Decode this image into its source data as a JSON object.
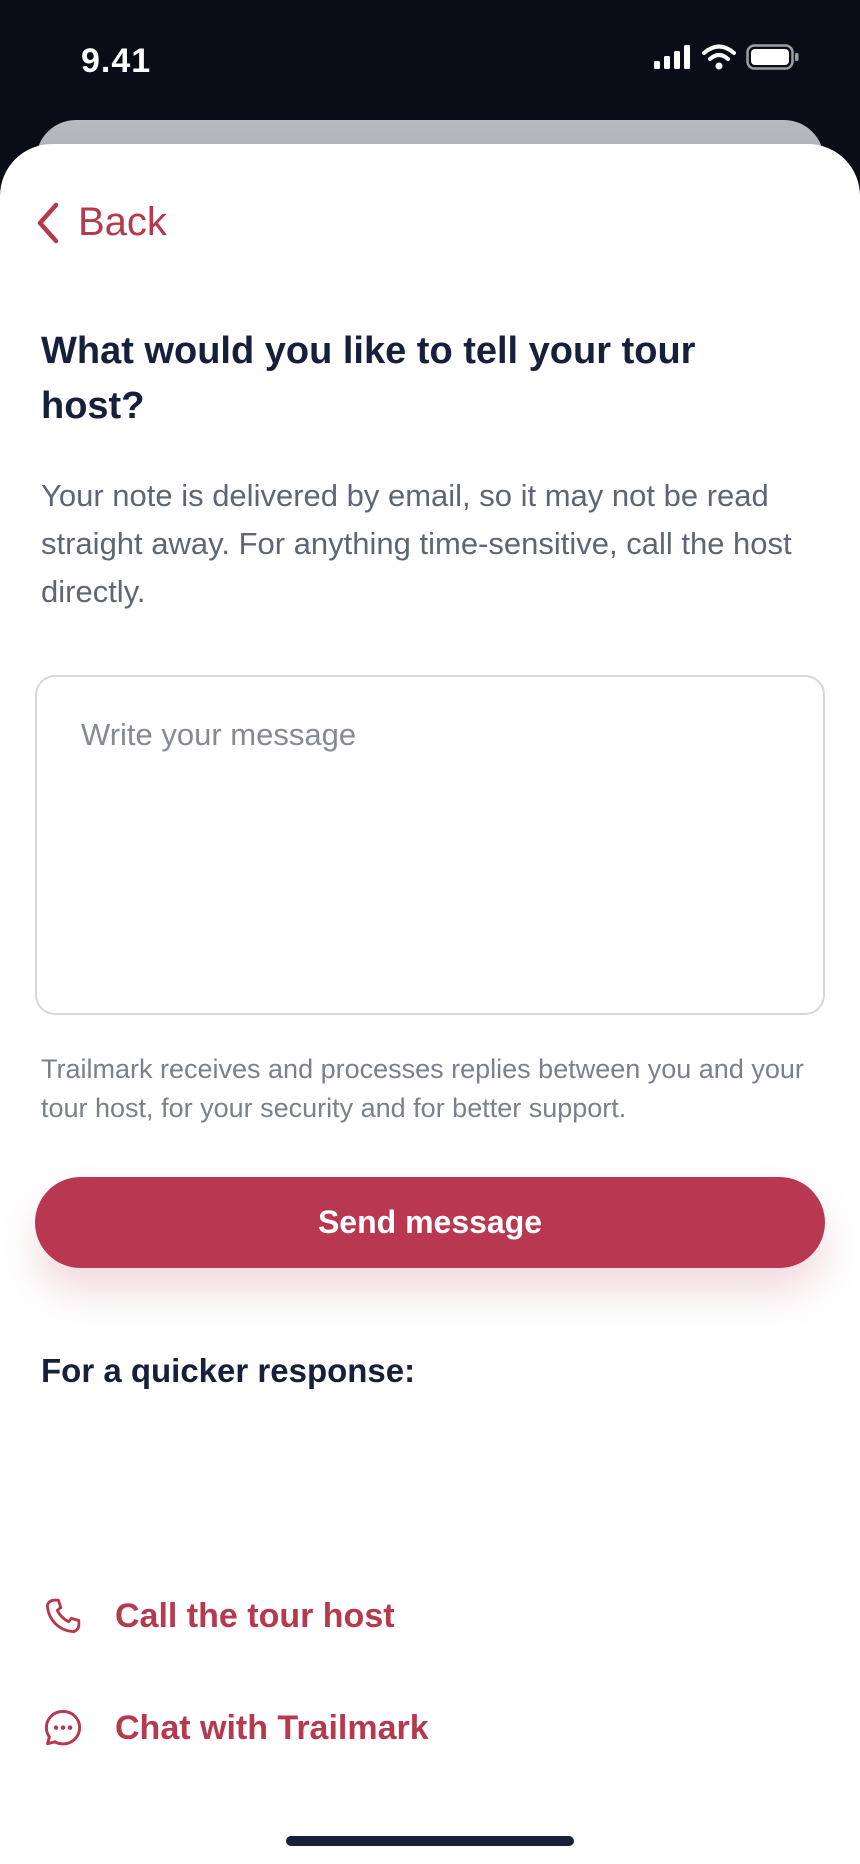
{
  "status_bar": {
    "time": "9.41",
    "icons": [
      "signal-icon",
      "wifi-icon",
      "battery-icon"
    ]
  },
  "header": {
    "back_label": "Back"
  },
  "main": {
    "title": "What would you like to tell your tour host?",
    "intro": "Your note is delivered by email, so it may not be read straight away. For anything time-sensitive, call the host directly.",
    "message_placeholder": "Write your message",
    "message_value": "",
    "disclaimer": "Trailmark receives and processes replies between you and your tour host, for your security and for better support.",
    "send_label": "Send message"
  },
  "quick_response": {
    "heading": "For a quicker response:",
    "call_label": "Call the tour host",
    "chat_label": "Chat with Trailmark"
  },
  "colors": {
    "accent": "#b73850",
    "heading": "#17203a",
    "body_text": "#5e6676",
    "background_dark": "#0a0d18"
  }
}
